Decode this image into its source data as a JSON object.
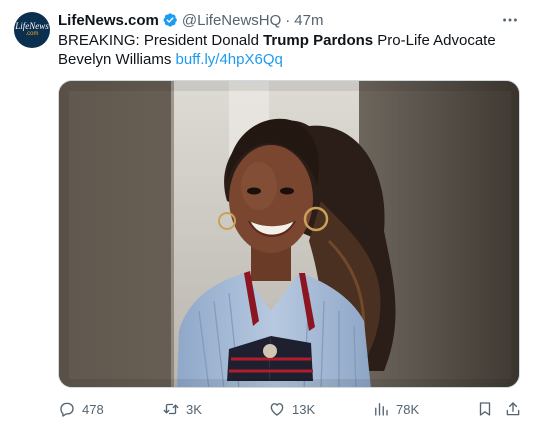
{
  "author": {
    "avatar_line1": "LifeNews",
    "avatar_line2": ".com",
    "name": "LifeNews.com",
    "handle": "@LifeNewsHQ",
    "separator": "·",
    "time": "47m",
    "verified_icon": "verified-badge-icon"
  },
  "tweet": {
    "text_part1": "BREAKING: President Donald ",
    "text_bold": "Trump Pardons",
    "text_part2": " Pro-Life Advocate Bevelyn Williams ",
    "link": "buff.ly/4hpX6Qq",
    "link_color": "#1d9bf0"
  },
  "actions": {
    "reply": {
      "icon": "reply-icon",
      "count": "478"
    },
    "retweet": {
      "icon": "retweet-icon",
      "count": "3K"
    },
    "like": {
      "icon": "heart-icon",
      "count": "13K"
    },
    "views": {
      "icon": "views-chart-icon",
      "count": "78K"
    },
    "bookmark": {
      "icon": "bookmark-icon"
    },
    "share": {
      "icon": "share-icon"
    }
  },
  "colors": {
    "text": "#0f1419",
    "secondary": "#536471",
    "accent": "#1d9bf0"
  }
}
